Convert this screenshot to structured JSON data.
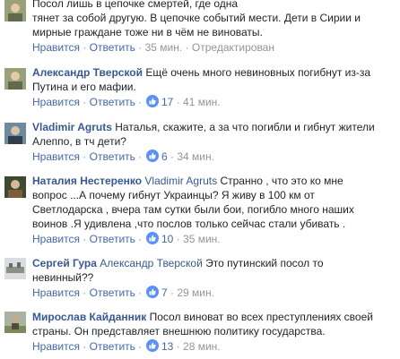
{
  "comments": [
    {
      "author": "",
      "text_lines": [
        "Посол лишь в цепочке смертей, где одна",
        "тянет за собой другую. В цепочке событий мести. Дети в Сирии и",
        "мирные граждане тоже ни в чём не виноваты."
      ],
      "like_label": "Нравится",
      "reply_label": "Ответить",
      "time": "35 мин.",
      "edited": "Отредактирован"
    },
    {
      "author": "Александр Тверской",
      "text_lines": [
        "Ещё очень много невиновных погибнут из-за",
        "Путина и его мафии."
      ],
      "like_label": "Нравится",
      "reply_label": "Ответить",
      "reaction_count": "17",
      "time": "41 мин."
    },
    {
      "author": "Vladimir Agruts",
      "text_lines": [
        "Наталья, скажите, а за что погибли и гибнут жители",
        "Алеппо, в тч дети?"
      ],
      "like_label": "Нравится",
      "reply_label": "Ответить",
      "reaction_count": "6",
      "time": "34 мин."
    },
    {
      "author": "Наталия Нестеренко",
      "mention": "Vladimir Agruts",
      "text_lines": [
        "Странно , что это ко мне",
        "вопрос ...А почему гибнут Украинцы? Я живу в 100 км от",
        "Светлодарска , вчера там сутки были бои, погибло много наших",
        "воинов .Я удивлена ,что послов только сейчас стали убивать ."
      ],
      "like_label": "Нравится",
      "reply_label": "Ответить",
      "reaction_count": "10",
      "time": "35 мин."
    },
    {
      "author": "Сергей Гура",
      "mention": "Александр Тверской",
      "text_lines": [
        "Это путинский посол то",
        "невинный??"
      ],
      "like_label": "Нравится",
      "reply_label": "Ответить",
      "reaction_count": "7",
      "time": "29 мин."
    },
    {
      "author": "Мирослав Кайданник",
      "text_lines": [
        "Посол виноват во всех преступлениях своей",
        "страны. Он представляет внешнюю политику государства."
      ],
      "like_label": "Нравится",
      "reply_label": "Ответить",
      "reaction_count": "13",
      "time": "28 мин."
    }
  ],
  "colors": {
    "author_link": "#365899",
    "action_link": "#4267b2",
    "meta_text": "#90949c",
    "body_text": "#1d2129",
    "like_icon_bg": "#5890ff"
  },
  "icons": {
    "like_reaction": "thumbs-up-icon"
  }
}
